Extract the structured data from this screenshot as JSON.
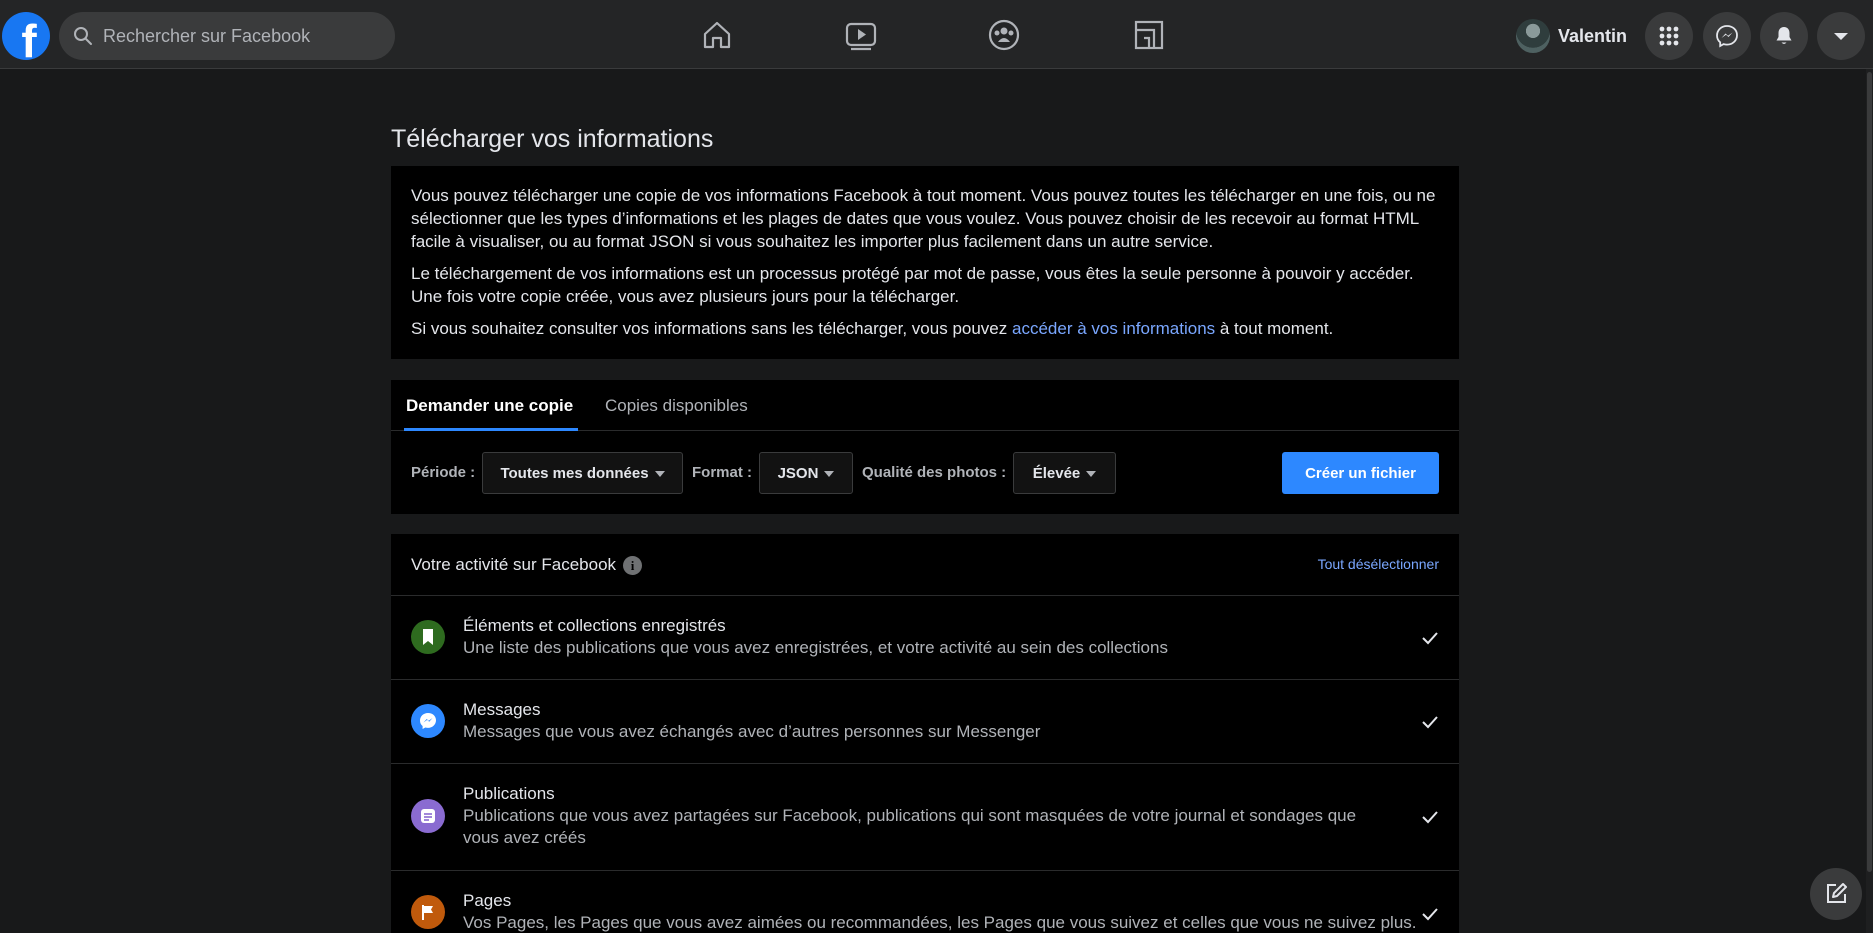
{
  "topbar": {
    "logo_letter": "f",
    "search_placeholder": "Rechercher sur Facebook",
    "nav_icons": [
      "home-icon",
      "watch-icon",
      "groups-icon",
      "gaming-icon"
    ],
    "profile_name": "Valentin",
    "action_icons": [
      "menu-grid-icon",
      "messenger-icon",
      "notifications-icon",
      "account-caret-icon"
    ]
  },
  "page": {
    "title": "Télécharger vos informations"
  },
  "info": {
    "paragraph1": "Vous pouvez télécharger une copie de vos informations Facebook à tout moment. Vous pouvez toutes les télécharger en une fois, ou ne sélectionner que les types d’informations et les plages de dates que vous voulez. Vous pouvez choisir de les recevoir au format HTML facile à visualiser, ou au format JSON si vous souhaitez les importer plus facilement dans un autre service.",
    "paragraph2": "Le téléchargement de vos informations est un processus protégé par mot de passe, vous êtes la seule personne à pouvoir y accéder. Une fois votre copie créée, vous avez plusieurs jours pour la télécharger.",
    "paragraph3_before": "Si vous souhaitez consulter vos informations sans les télécharger, vous pouvez ",
    "paragraph3_link": "accéder à vos informations",
    "paragraph3_after": " à tout moment."
  },
  "request": {
    "tab_active": "Demander une copie",
    "tab_other": "Copies disponibles",
    "period_label": "Période :",
    "period_value": "Toutes mes données",
    "format_label": "Format :",
    "format_value": "JSON",
    "quality_label": "Qualité des photos :",
    "quality_value": "Élevée",
    "create_button": "Créer un fichier"
  },
  "activity": {
    "title": "Votre activité sur Facebook",
    "info_glyph": "i",
    "deselect_all": "Tout désélectionner",
    "items": [
      {
        "icon": "bookmark-icon",
        "color": "#2e6b1f",
        "title": "Éléments et collections enregistrés",
        "description": "Une liste des publications que vous avez enregistrées, et votre activité au sein des collections",
        "checked": true
      },
      {
        "icon": "messenger-icon",
        "color": "#2d88ff",
        "title": "Messages",
        "description": "Messages que vous avez échangés avec d’autres personnes sur Messenger",
        "checked": true
      },
      {
        "icon": "posts-icon",
        "color": "#8a6bd1",
        "title": "Publications",
        "description": "Publications que vous avez partagées sur Facebook, publications qui sont masquées de votre journal et sondages que vous avez créés",
        "checked": true
      },
      {
        "icon": "flag-icon",
        "color": "#c05a0c",
        "title": "Pages",
        "description": "Vos Pages, les Pages que vous avez aimées ou recommandées, les Pages que vous suivez et celles que vous ne suivez plus.",
        "checked": true
      }
    ]
  },
  "floating": {
    "compose_icon": "new-message-icon"
  }
}
